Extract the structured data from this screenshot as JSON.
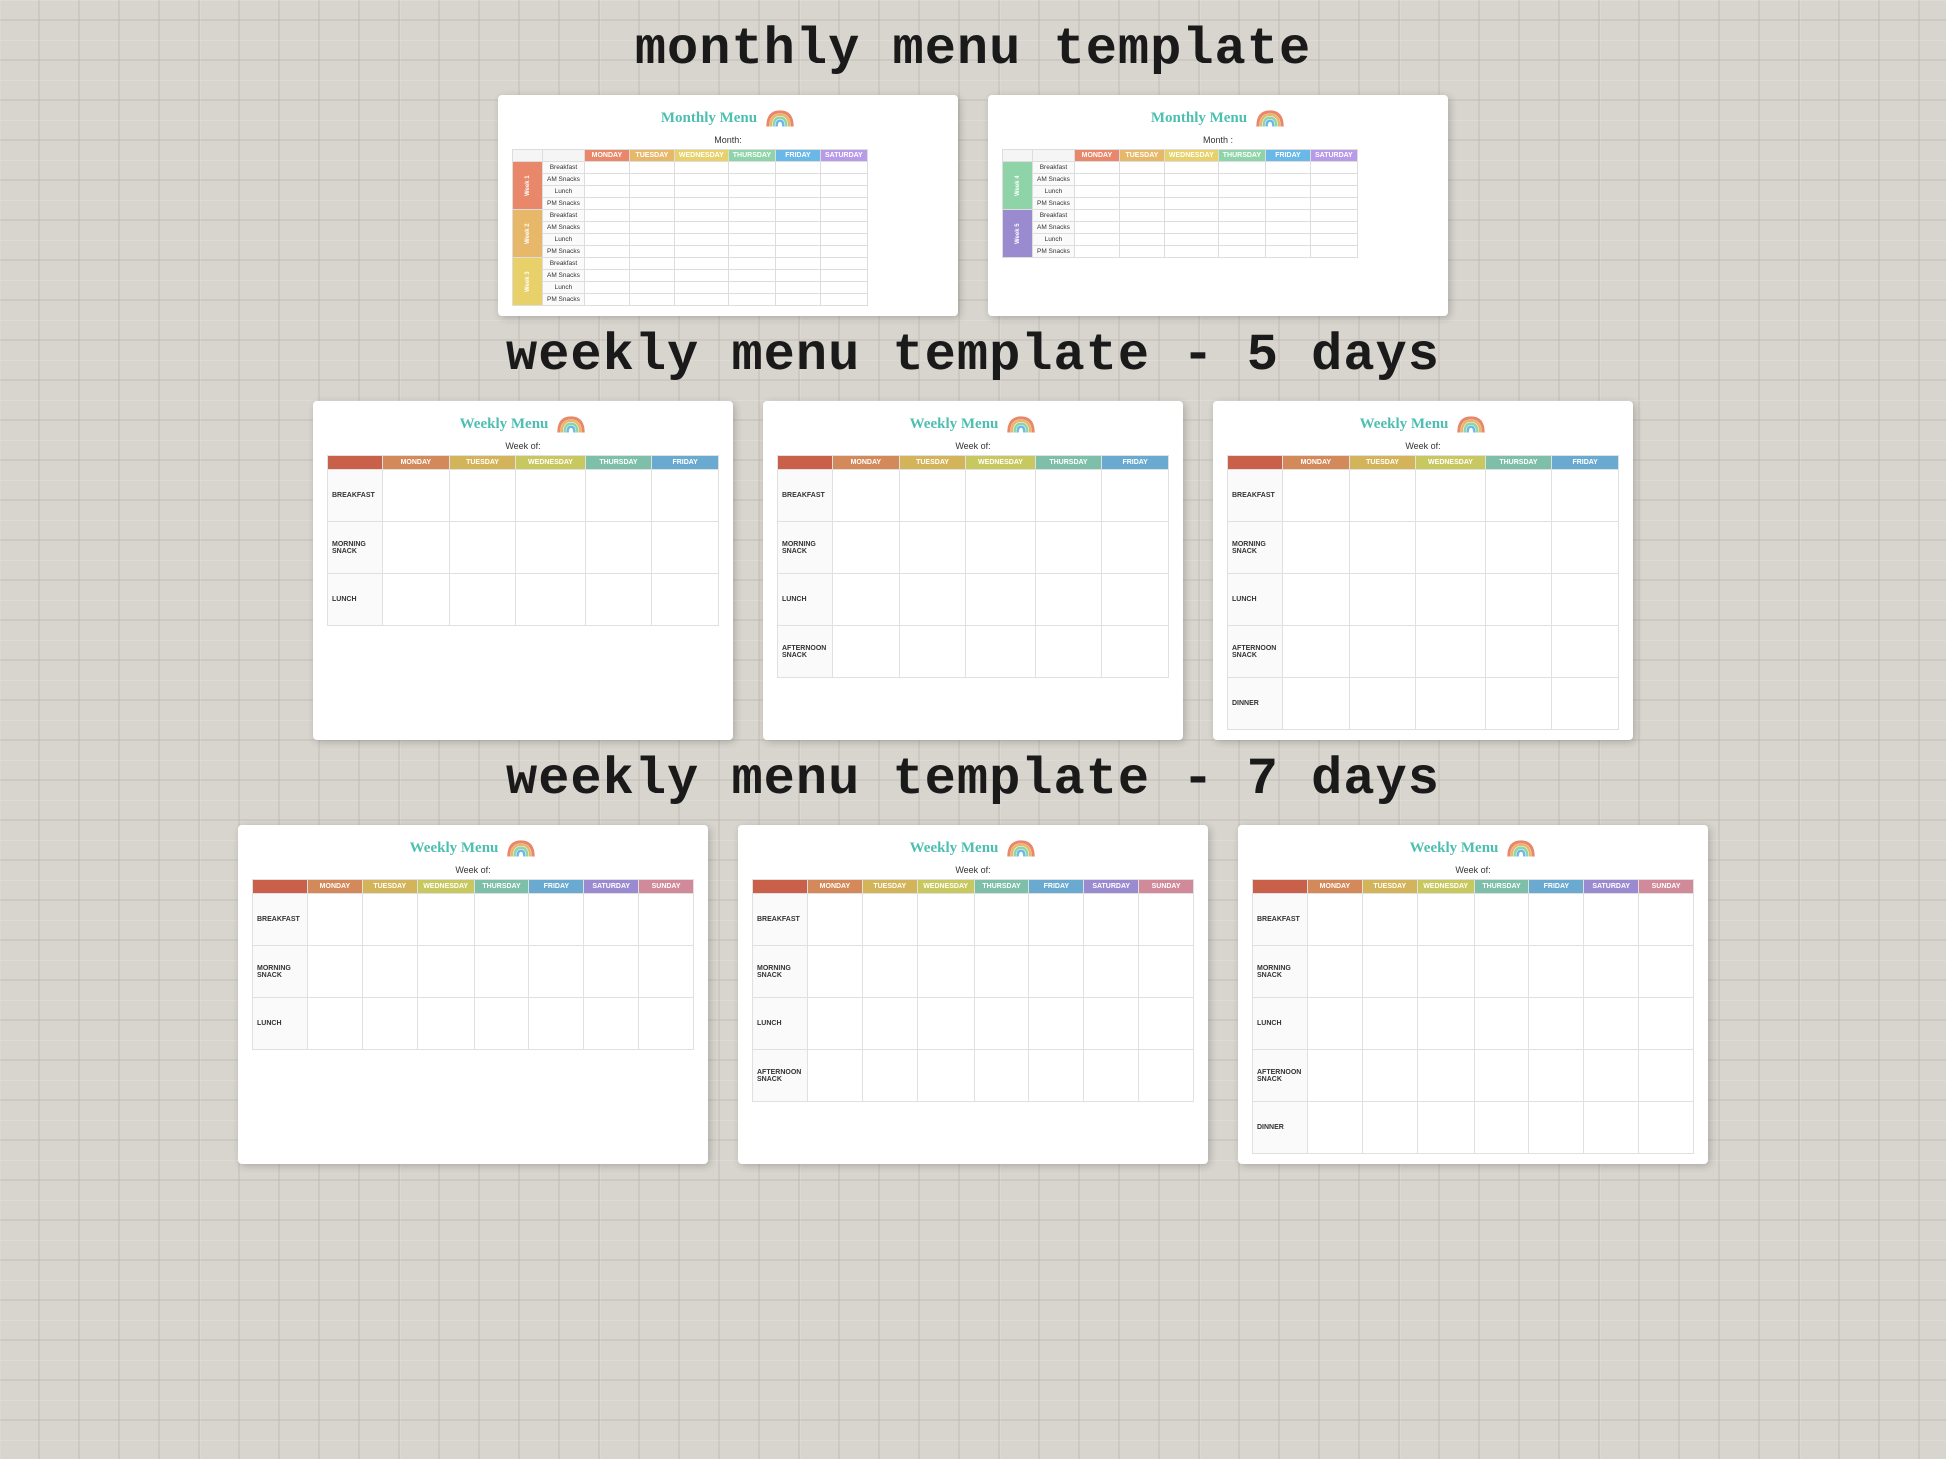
{
  "sections": [
    {
      "id": "monthly",
      "title": "monthly menu template",
      "cards": [
        {
          "id": "monthly-1",
          "title": "Monthly Menu",
          "month_label": "Month:",
          "days": [
            "MONDAY",
            "TUESDAY",
            "WEDNESDAY",
            "THURSDAY",
            "FRIDAY",
            "SATURDAY"
          ],
          "weeks": [
            {
              "label": "Week 1",
              "meals": [
                "Breakfast",
                "AM Snacks",
                "Lunch",
                "PM Snacks"
              ]
            },
            {
              "label": "Week 2",
              "meals": [
                "Breakfast",
                "AM Snacks",
                "Lunch",
                "PM Snacks"
              ]
            },
            {
              "label": "Week 3",
              "meals": [
                "Breakfast",
                "AM Snacks",
                "Lunch",
                "PM Snacks"
              ]
            }
          ]
        },
        {
          "id": "monthly-2",
          "title": "Monthly Menu",
          "month_label": "Month :",
          "days": [
            "MONDAY",
            "TUESDAY",
            "WEDNESDAY",
            "THURSDAY",
            "FRIDAY",
            "SATURDAY"
          ],
          "weeks": [
            {
              "label": "Week 4",
              "meals": [
                "Breakfast",
                "AM Snacks",
                "Lunch",
                "PM Snacks"
              ]
            },
            {
              "label": "Week 5",
              "meals": [
                "Breakfast",
                "AM Snacks",
                "Lunch",
                "PM Snacks"
              ]
            }
          ]
        }
      ]
    },
    {
      "id": "weekly5",
      "title": "weekly menu template - 5 days",
      "cards": [
        {
          "id": "weekly5-1",
          "title": "Weekly Menu",
          "weekof": "Week of:",
          "days": [
            "MONDAY",
            "TUESDAY",
            "WEDNESDAY",
            "THURSDAY",
            "FRIDAY"
          ],
          "meals": [
            "BREAKFAST",
            "MORNING\nSNACK",
            "LUNCH"
          ]
        },
        {
          "id": "weekly5-2",
          "title": "Weekly Menu",
          "weekof": "Week of:",
          "days": [
            "MONDAY",
            "TUESDAY",
            "WEDNESDAY",
            "THURSDAY",
            "FRIDAY"
          ],
          "meals": [
            "BREAKFAST",
            "MORNING\nSNACK",
            "LUNCH",
            "AFTERNOON\nSNACK"
          ]
        },
        {
          "id": "weekly5-3",
          "title": "Weekly Menu",
          "weekof": "Week of:",
          "days": [
            "MONDAY",
            "TUESDAY",
            "WEDNESDAY",
            "THURSDAY",
            "FRIDAY"
          ],
          "meals": [
            "BREAKFAST",
            "MORNING\nSNACK",
            "LUNCH",
            "AFTERNOON\nSNACK",
            "DINNER"
          ]
        }
      ]
    },
    {
      "id": "weekly7",
      "title": "weekly menu template - 7 days",
      "cards": [
        {
          "id": "weekly7-1",
          "title": "Weekly Menu",
          "weekof": "Week of:",
          "days": [
            "MONDAY",
            "TUESDAY",
            "WEDNESDAY",
            "THURSDAY",
            "FRIDAY",
            "SATURDAY",
            "SUNDAY"
          ],
          "meals": [
            "BREAKFAST",
            "MORNING\nSNACK",
            "LUNCH"
          ]
        },
        {
          "id": "weekly7-2",
          "title": "Weekly Menu",
          "weekof": "Week of:",
          "days": [
            "MONDAY",
            "TUESDAY",
            "WEDNESDAY",
            "THURSDAY",
            "FRIDAY",
            "SATURDAY",
            "SUNDAY"
          ],
          "meals": [
            "BREAKFAST",
            "MORNING\nSNACK",
            "LUNCH",
            "AFTERNOON\nSNACK"
          ]
        },
        {
          "id": "weekly7-3",
          "title": "Weekly Menu",
          "weekof": "Week of:",
          "days": [
            "MONDAY",
            "TUESDAY",
            "WEDNESDAY",
            "THURSDAY",
            "FRIDAY",
            "SATURDAY",
            "SUNDAY"
          ],
          "meals": [
            "BREAKFAST",
            "MORNING\nSNACK",
            "LUNCH",
            "AFTERNOON\nSNACK",
            "DINNER"
          ]
        }
      ]
    }
  ],
  "snack_label": "SNaCK",
  "colors": {
    "teal": "#4dbfb0",
    "brick": "#1a1a1a",
    "col1": "#c9614a",
    "col2": "#d4895a",
    "col3": "#d4b45a",
    "col4": "#c8c860",
    "col5": "#7dbfa8",
    "col6": "#6aaad0",
    "col7": "#9a8ad0",
    "col8": "#d08a9a"
  }
}
